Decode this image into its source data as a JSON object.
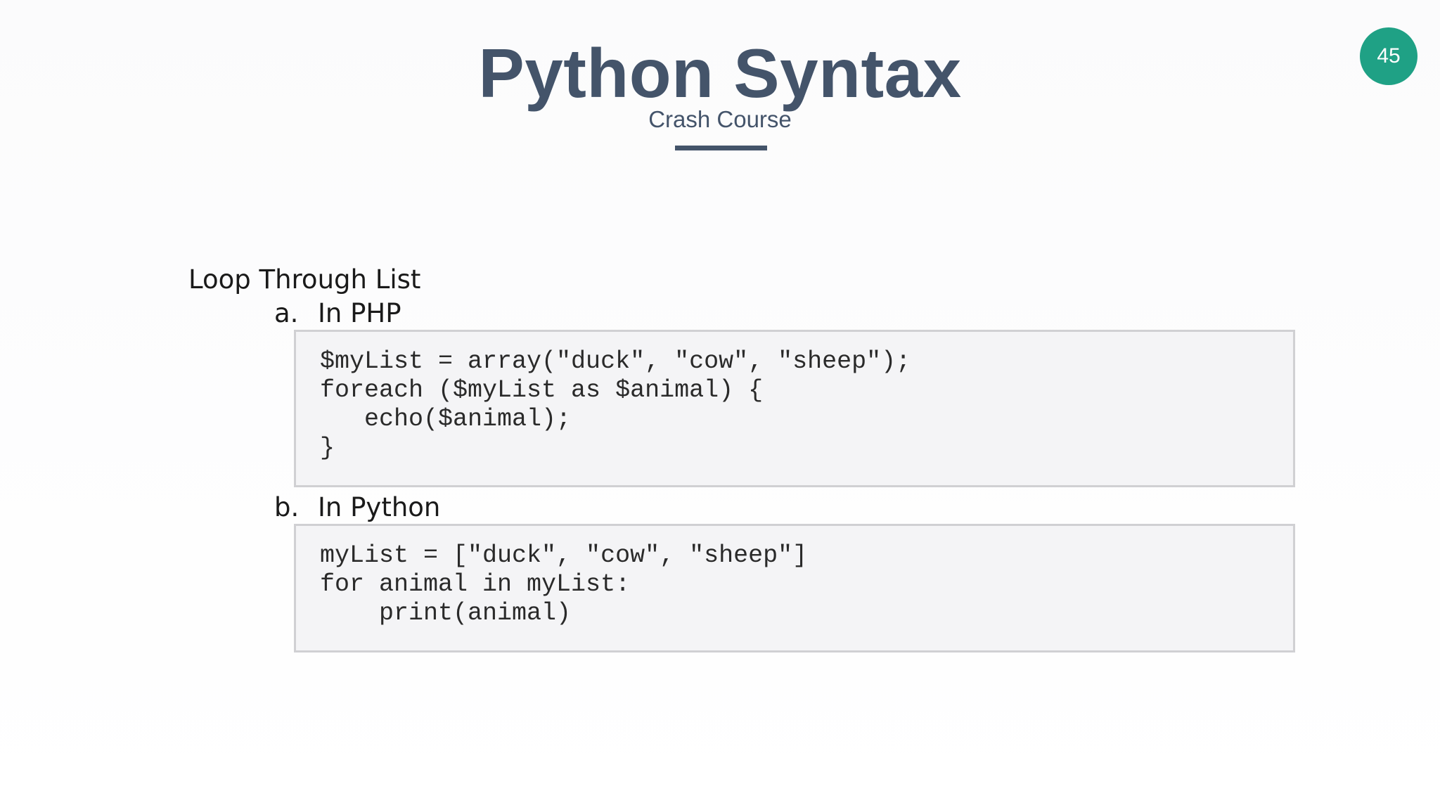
{
  "slide": {
    "title": "Python Syntax",
    "subtitle": "Crash Course",
    "page_number": "45",
    "heading": "Loop Through List",
    "items": [
      {
        "marker": "a.",
        "label": "In PHP",
        "code": [
          "$myList = array(\"duck\", \"cow\", \"sheep\");",
          "foreach ($myList as $animal) {",
          "   echo($animal);",
          "}"
        ]
      },
      {
        "marker": "b.",
        "label": "In Python",
        "code": [
          "myList = [\"duck\", \"cow\", \"sheep\"]",
          "for animal in myList:",
          "    print(animal)"
        ]
      }
    ]
  },
  "colors": {
    "title": "#44546a",
    "badge": "#1fa185",
    "code_background": "#f4f4f6",
    "code_border": "#d0d0d3"
  }
}
